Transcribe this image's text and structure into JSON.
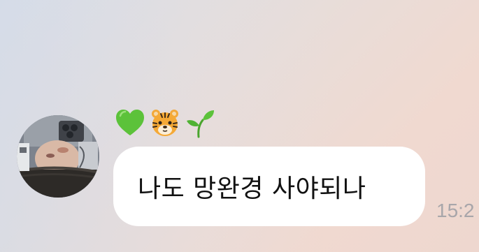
{
  "message": {
    "sender": {
      "avatar": "avatar-photo",
      "name_icons": [
        "green-heart-icon",
        "tiger-face-icon",
        "seedling-icon"
      ]
    },
    "text": "나도 망완경 사야되나",
    "timestamp": "15:2"
  },
  "colors": {
    "bubble": "#ffffff",
    "text": "#111111",
    "timestamp": "#a8a6aa"
  }
}
